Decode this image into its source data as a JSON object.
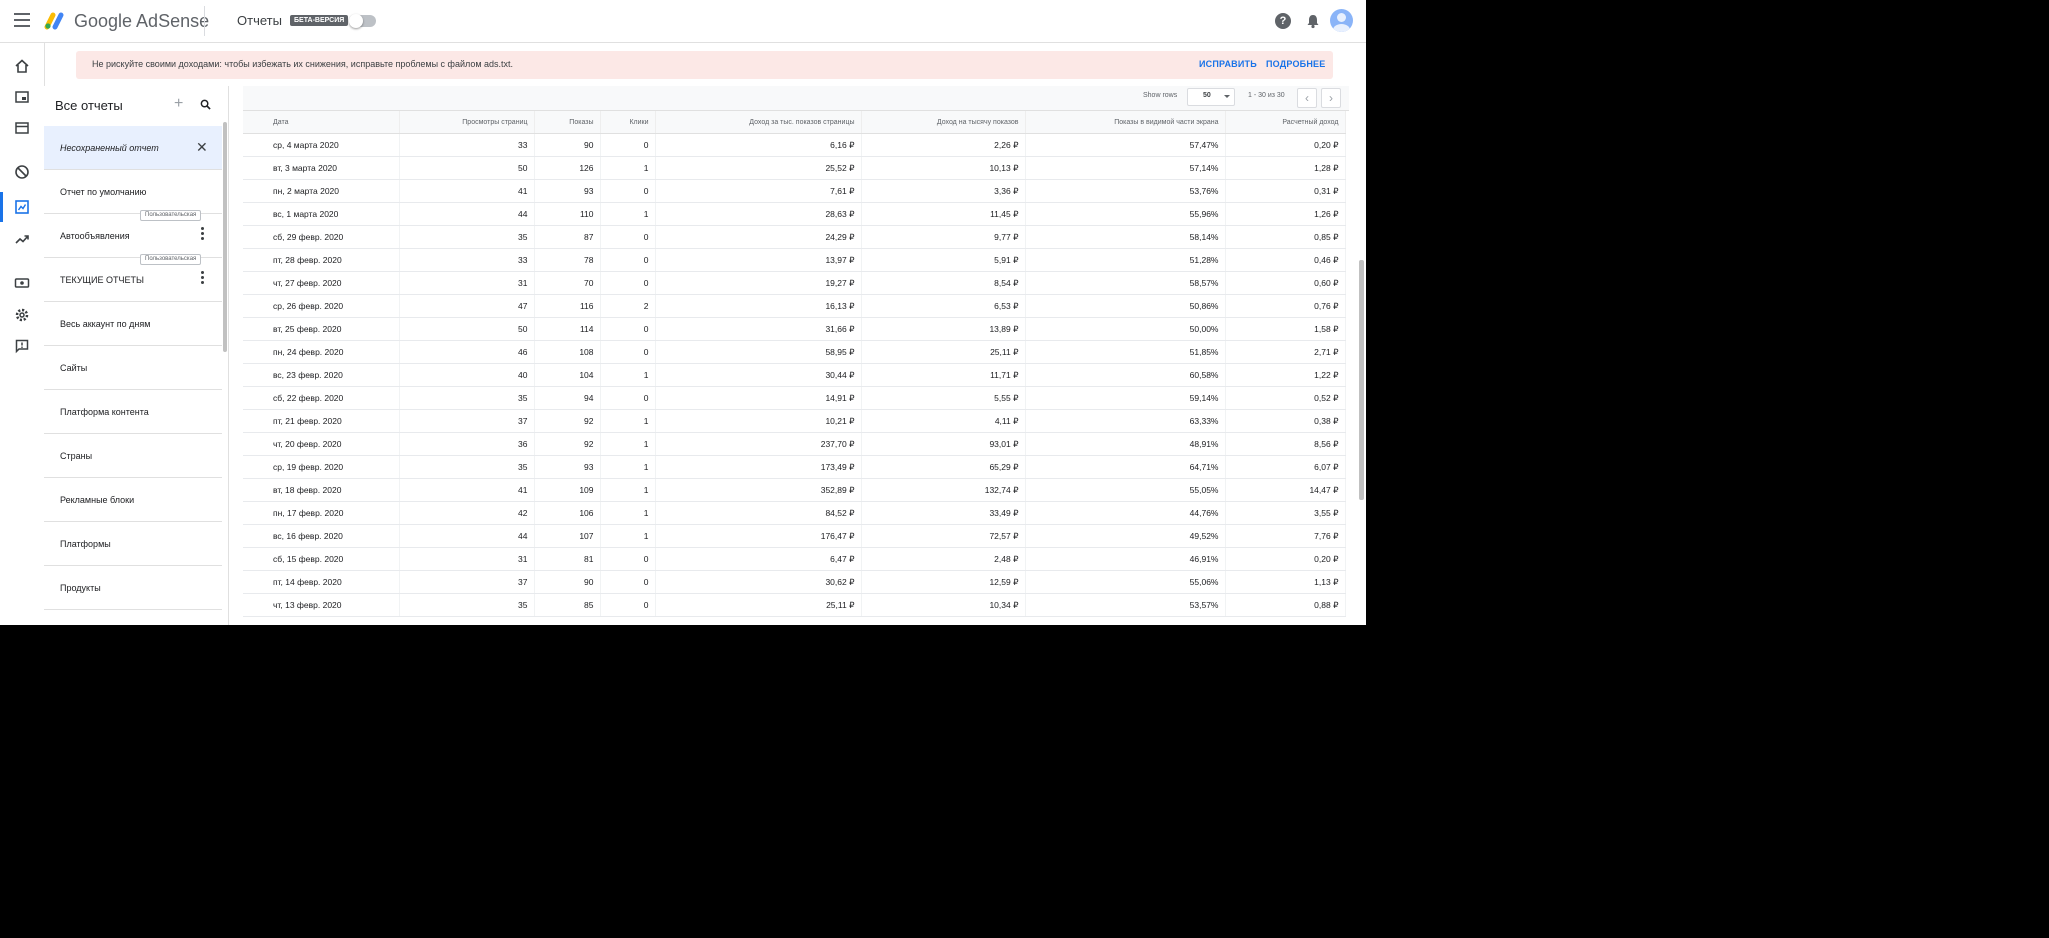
{
  "header": {
    "brand": "Google AdSense",
    "page": "Отчеты",
    "beta": "БЕТА-ВЕРСИЯ"
  },
  "banner": {
    "text": "Не рискуйте своими доходами: чтобы избежать их снижения, исправьте проблемы с файлом ads.txt.",
    "fix": "ИСПРАВИТЬ",
    "details": "ПОДРОБНЕЕ"
  },
  "sidebar": {
    "title": "Все отчеты",
    "items": [
      {
        "label": "Несохраненный отчет"
      },
      {
        "label": "Отчет по умолчанию"
      },
      {
        "label": "Автообъявления",
        "tag": "Пользовательская"
      },
      {
        "label": "ТЕКУЩИЕ ОТЧЕТЫ",
        "tag": "Пользовательская"
      },
      {
        "label": "Весь аккаунт по дням"
      },
      {
        "label": "Сайты"
      },
      {
        "label": "Платформа контента"
      },
      {
        "label": "Страны"
      },
      {
        "label": "Рекламные блоки"
      },
      {
        "label": "Платформы"
      },
      {
        "label": "Продукты"
      }
    ]
  },
  "table": {
    "rows_label": "Show rows",
    "rows_value": "50",
    "range": "1 - 30 из 30",
    "columns": [
      "Дата",
      "Просмотры страниц",
      "Показы",
      "Клики",
      "Доход за тыс. показов страницы",
      "Доход на тысячу показов",
      "Показы в видимой части экрана",
      "Расчетный доход"
    ],
    "rows": [
      [
        "ср, 4 марта 2020",
        "33",
        "90",
        "0",
        "6,16 ₽",
        "2,26 ₽",
        "57,47%",
        "0,20 ₽"
      ],
      [
        "вт, 3 марта 2020",
        "50",
        "126",
        "1",
        "25,52 ₽",
        "10,13 ₽",
        "57,14%",
        "1,28 ₽"
      ],
      [
        "пн, 2 марта 2020",
        "41",
        "93",
        "0",
        "7,61 ₽",
        "3,36 ₽",
        "53,76%",
        "0,31 ₽"
      ],
      [
        "вс, 1 марта 2020",
        "44",
        "110",
        "1",
        "28,63 ₽",
        "11,45 ₽",
        "55,96%",
        "1,26 ₽"
      ],
      [
        "сб, 29 февр. 2020",
        "35",
        "87",
        "0",
        "24,29 ₽",
        "9,77 ₽",
        "58,14%",
        "0,85 ₽"
      ],
      [
        "пт, 28 февр. 2020",
        "33",
        "78",
        "0",
        "13,97 ₽",
        "5,91 ₽",
        "51,28%",
        "0,46 ₽"
      ],
      [
        "чт, 27 февр. 2020",
        "31",
        "70",
        "0",
        "19,27 ₽",
        "8,54 ₽",
        "58,57%",
        "0,60 ₽"
      ],
      [
        "ср, 26 февр. 2020",
        "47",
        "116",
        "2",
        "16,13 ₽",
        "6,53 ₽",
        "50,86%",
        "0,76 ₽"
      ],
      [
        "вт, 25 февр. 2020",
        "50",
        "114",
        "0",
        "31,66 ₽",
        "13,89 ₽",
        "50,00%",
        "1,58 ₽"
      ],
      [
        "пн, 24 февр. 2020",
        "46",
        "108",
        "0",
        "58,95 ₽",
        "25,11 ₽",
        "51,85%",
        "2,71 ₽"
      ],
      [
        "вс, 23 февр. 2020",
        "40",
        "104",
        "1",
        "30,44 ₽",
        "11,71 ₽",
        "60,58%",
        "1,22 ₽"
      ],
      [
        "сб, 22 февр. 2020",
        "35",
        "94",
        "0",
        "14,91 ₽",
        "5,55 ₽",
        "59,14%",
        "0,52 ₽"
      ],
      [
        "пт, 21 февр. 2020",
        "37",
        "92",
        "1",
        "10,21 ₽",
        "4,11 ₽",
        "63,33%",
        "0,38 ₽"
      ],
      [
        "чт, 20 февр. 2020",
        "36",
        "92",
        "1",
        "237,70 ₽",
        "93,01 ₽",
        "48,91%",
        "8,56 ₽"
      ],
      [
        "ср, 19 февр. 2020",
        "35",
        "93",
        "1",
        "173,49 ₽",
        "65,29 ₽",
        "64,71%",
        "6,07 ₽"
      ],
      [
        "вт, 18 февр. 2020",
        "41",
        "109",
        "1",
        "352,89 ₽",
        "132,74 ₽",
        "55,05%",
        "14,47 ₽"
      ],
      [
        "пн, 17 февр. 2020",
        "42",
        "106",
        "1",
        "84,52 ₽",
        "33,49 ₽",
        "44,76%",
        "3,55 ₽"
      ],
      [
        "вс, 16 февр. 2020",
        "44",
        "107",
        "1",
        "176,47 ₽",
        "72,57 ₽",
        "49,52%",
        "7,76 ₽"
      ],
      [
        "сб, 15 февр. 2020",
        "31",
        "81",
        "0",
        "6,47 ₽",
        "2,48 ₽",
        "46,91%",
        "0,20 ₽"
      ],
      [
        "пт, 14 февр. 2020",
        "37",
        "90",
        "0",
        "30,62 ₽",
        "12,59 ₽",
        "55,06%",
        "1,13 ₽"
      ],
      [
        "чт, 13 февр. 2020",
        "35",
        "85",
        "0",
        "25,11 ₽",
        "10,34 ₽",
        "53,57%",
        "0,88 ₽"
      ]
    ]
  },
  "colors": {
    "accent": "#1a73e8",
    "banner_bg": "#fce8e6",
    "selected_bg": "#e8f0fe"
  }
}
